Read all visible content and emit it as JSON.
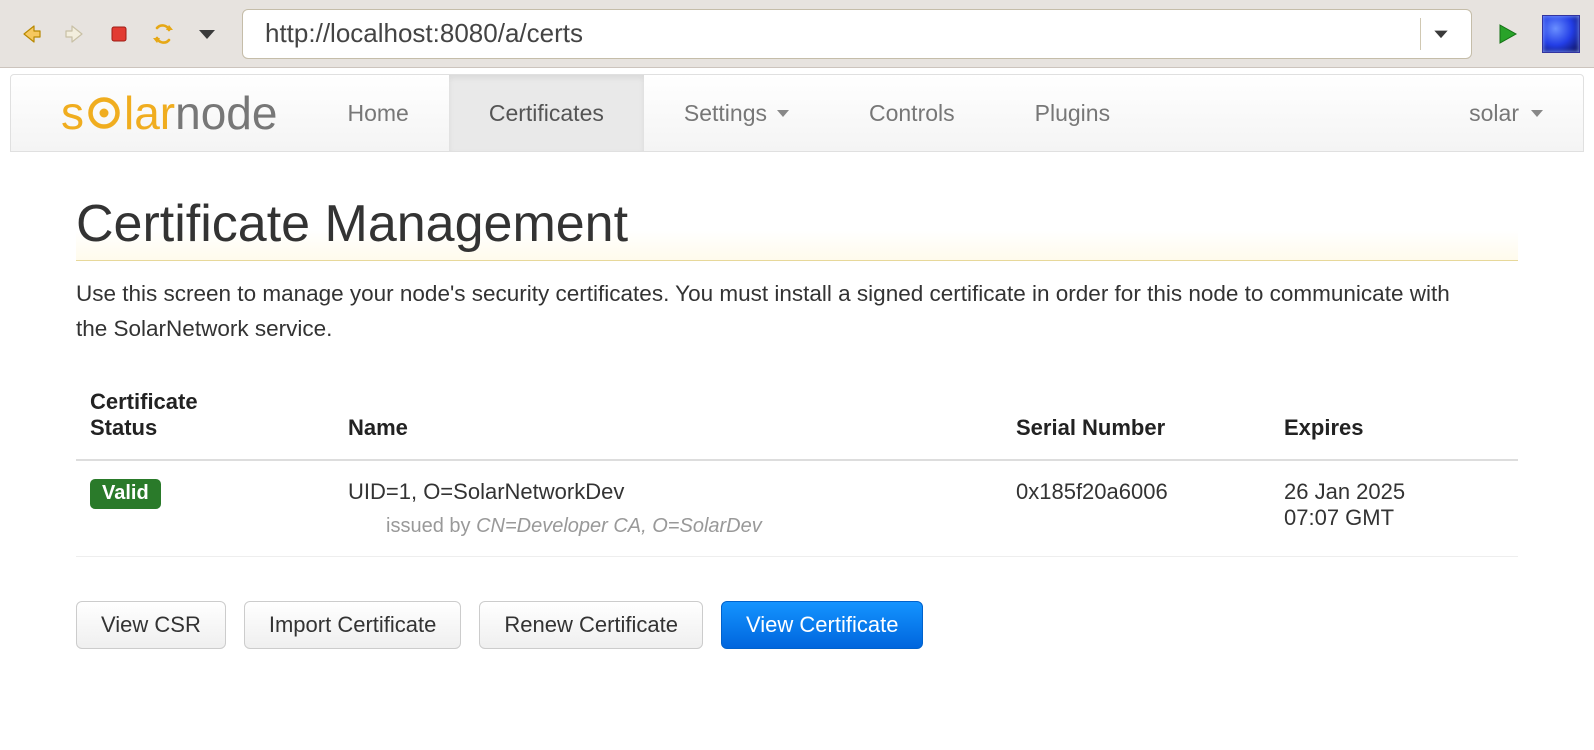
{
  "browser": {
    "url": "http://localhost:8080/a/certs"
  },
  "brand": {
    "prefix": "s",
    "mid": "lar",
    "suffix": "node"
  },
  "nav": {
    "items": [
      {
        "label": "Home",
        "active": false,
        "dropdown": false
      },
      {
        "label": "Certificates",
        "active": true,
        "dropdown": false
      },
      {
        "label": "Settings",
        "active": false,
        "dropdown": true
      },
      {
        "label": "Controls",
        "active": false,
        "dropdown": false
      },
      {
        "label": "Plugins",
        "active": false,
        "dropdown": false
      }
    ],
    "user_label": "solar"
  },
  "page": {
    "title": "Certificate Management",
    "lead": "Use this screen to manage your node's security certificates. You must install a signed certificate in order for this node to communicate with the SolarNetwork service."
  },
  "table": {
    "headers": {
      "status_line1": "Certificate",
      "status_line2": "Status",
      "name": "Name",
      "serial": "Serial Number",
      "expires": "Expires"
    },
    "row": {
      "status_badge": "Valid",
      "name": "UID=1, O=SolarNetworkDev",
      "issued_by_prefix": "issued by ",
      "issued_by_dn": "CN=Developer CA, O=SolarDev",
      "serial": "0x185f20a6006",
      "expires_line1": "26 Jan 2025",
      "expires_line2": "07:07 GMT"
    }
  },
  "buttons": {
    "view_csr": "View CSR",
    "import_cert": "Import Certificate",
    "renew_cert": "Renew Certificate",
    "view_cert": "View Certificate"
  }
}
